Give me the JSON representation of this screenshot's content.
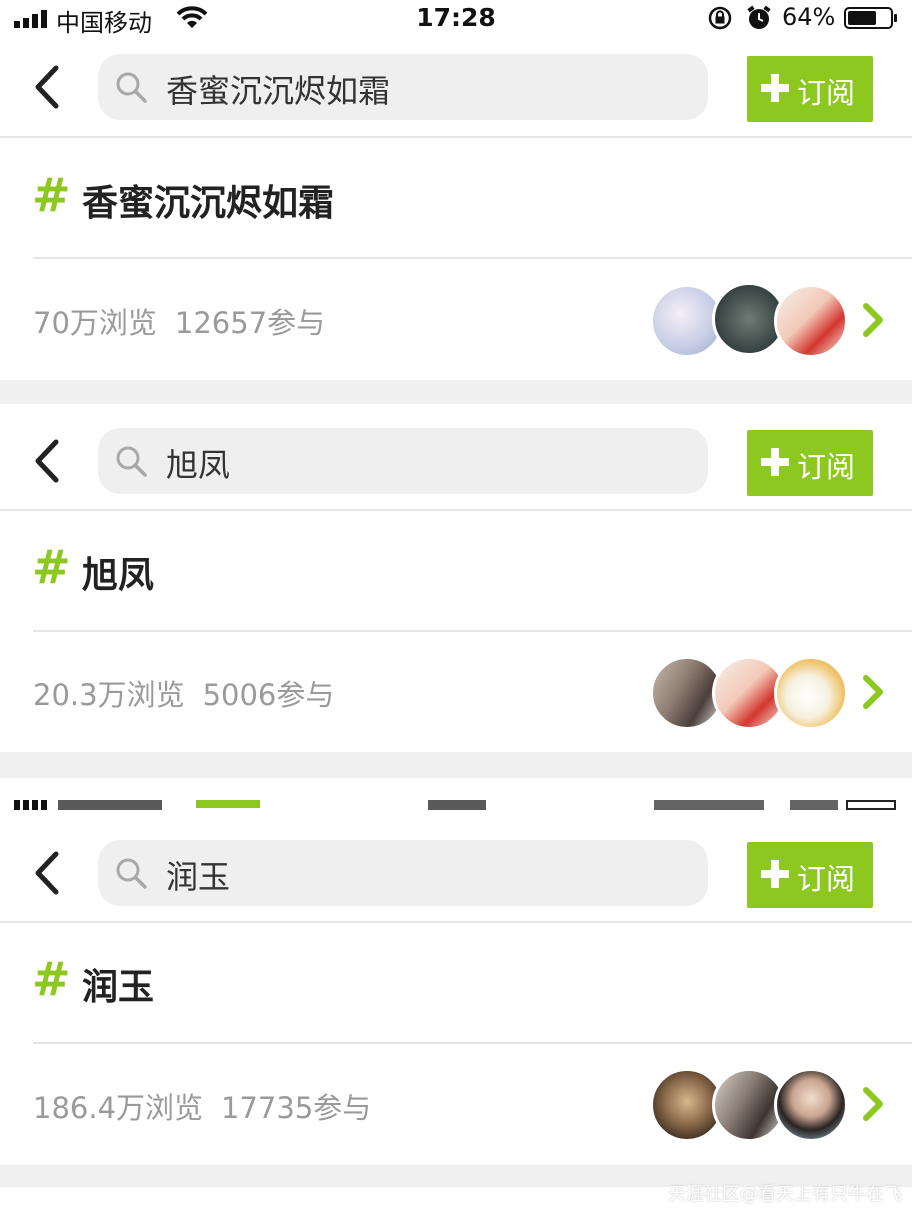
{
  "status_bar": {
    "carrier": "中国移动",
    "time": "17:28",
    "battery": "64%",
    "icons": [
      "signal-icon",
      "wifi-icon",
      "rotation-lock-icon",
      "alarm-icon",
      "battery-icon"
    ]
  },
  "theme": {
    "accent": "#8cc81f",
    "muted_text": "#9a9a9a",
    "search_bg": "#efefef",
    "band": "#f0f0f0"
  },
  "cards": [
    {
      "search_query": "香蜜沉沉烬如霜",
      "subscribe_label": "订阅",
      "topic_hash": "#",
      "topic_title": "香蜜沉沉烬如霜",
      "views": "70万浏览",
      "participants": "12657参与"
    },
    {
      "search_query": "旭凤",
      "subscribe_label": "订阅",
      "topic_hash": "#",
      "topic_title": "旭凤",
      "views": "20.3万浏览",
      "participants": "5006参与"
    },
    {
      "search_query": "润玉",
      "subscribe_label": "订阅",
      "topic_hash": "#",
      "topic_title": "润玉",
      "views": "186.4万浏览",
      "participants": "17735参与"
    }
  ],
  "watermark": "天涯社区@看天上有只牛在飞"
}
